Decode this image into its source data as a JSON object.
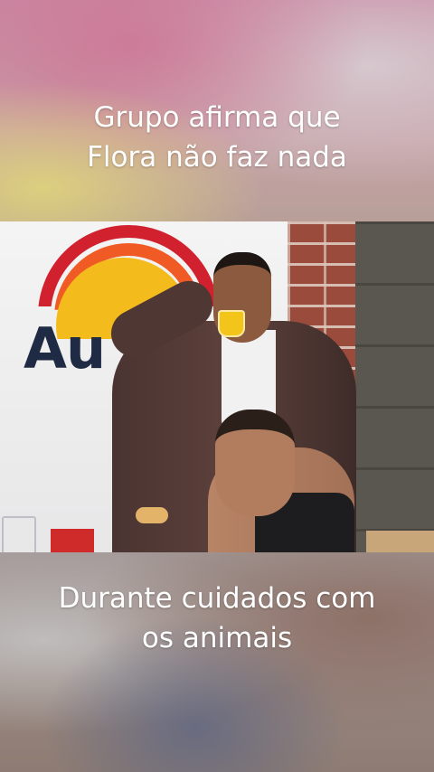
{
  "caption_top": {
    "line1": "Grupo afirma que",
    "line2": "Flora não faz nada"
  },
  "caption_bottom": {
    "line1": "Durante cuidados com",
    "line2": "os animais"
  },
  "video": {
    "sign_logo_text": "Au",
    "colors": {
      "logo_red": "#d1212e",
      "logo_orange": "#f05a24",
      "logo_yellow": "#f3bb1c",
      "logo_text": "#1f2a44"
    }
  }
}
